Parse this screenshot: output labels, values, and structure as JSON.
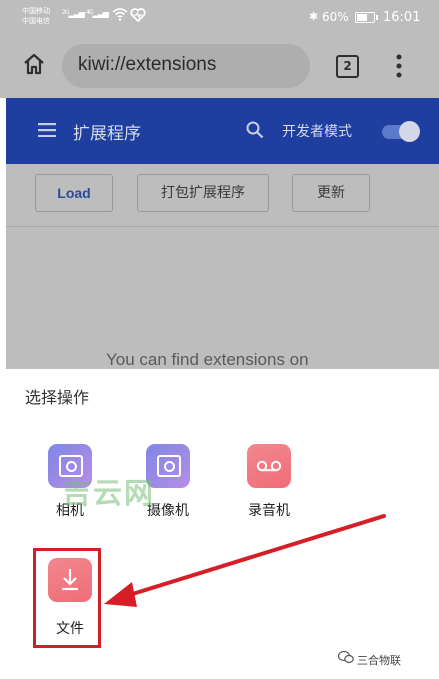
{
  "status_bar": {
    "carrier_1": "中国移动",
    "carrier_2": "中国电信",
    "signal_1": "2G",
    "signal_2": "4G",
    "battery": "60%",
    "time": "16:01"
  },
  "address_bar": {
    "url": "kiwi://extensions",
    "tab_count": "2"
  },
  "header": {
    "title": "扩展程序",
    "developer_mode_label": "开发者模式",
    "developer_mode_on": true,
    "color": "#1e3fa0"
  },
  "toolbar": {
    "load_label": "Load",
    "pack_label": "打包扩展程序",
    "update_label": "更新"
  },
  "content": {
    "partial_text": "You can find extensions on"
  },
  "sheet": {
    "title": "选择操作",
    "actions": [
      {
        "label": "相机",
        "icon": "camera-icon"
      },
      {
        "label": "摄像机",
        "icon": "video-camera-icon"
      },
      {
        "label": "录音机",
        "icon": "voicemail-icon"
      },
      {
        "label": "文件",
        "icon": "download-icon"
      }
    ]
  },
  "overlay": {
    "watermark": "吉云网",
    "brand": "三合物联",
    "highlight_color": "#d51e25"
  }
}
